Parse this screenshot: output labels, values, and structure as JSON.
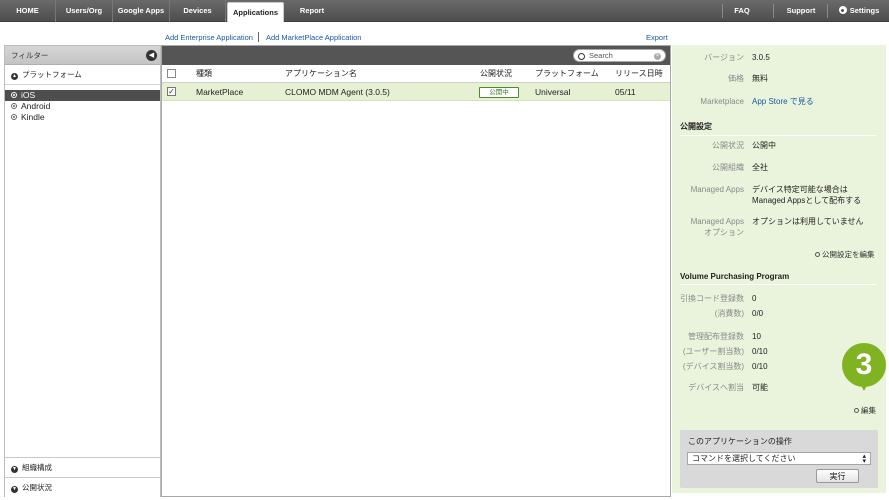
{
  "nav": {
    "tabs": [
      "HOME",
      "Users/Org",
      "Google Apps",
      "Devices",
      "Applications",
      "Report"
    ],
    "active": "Applications",
    "right": {
      "faq": "FAQ",
      "support": "Support",
      "settings": "Settings"
    }
  },
  "links": {
    "add_enterprise": "Add Enterprise Application",
    "separator": "|",
    "add_marketplace": "Add MarketPlace Application",
    "export": "Export"
  },
  "filter": {
    "title": "フィルター",
    "platform_header": "プラットフォーム",
    "platforms": [
      "iOS",
      "Android",
      "Kindle"
    ],
    "selected_platform": "iOS",
    "org_section": "組織構成",
    "status_section": "公開状況"
  },
  "search": {
    "placeholder": "Search"
  },
  "table": {
    "columns": [
      "種類",
      "アプリケーション名",
      "公開状況",
      "プラットフォーム",
      "リリース日時"
    ],
    "rows": [
      {
        "type": "MarketPlace",
        "name": "CLOMO MDM Agent (3.0.5)",
        "status": "公開中",
        "platform": "Universal",
        "release": "05/11",
        "checked": true
      }
    ]
  },
  "detail": {
    "version_label": "バージョン",
    "version": "3.0.5",
    "price_label": "価格",
    "price": "無料",
    "marketplace_label": "Marketplace",
    "marketplace_link": "App Store で見る",
    "publish_settings": "公開設定",
    "status_label": "公開状況",
    "status": "公開中",
    "org_label": "公開組織",
    "org": "全社",
    "managed_label": "Managed Apps",
    "managed_value_1": "デバイス特定可能な場合は",
    "managed_value_2": "Managed Appsとして配布する",
    "managed_opt_label_1": "Managed Apps",
    "managed_opt_label_2": "オプション",
    "managed_opt_value": "オプションは利用していません",
    "edit_publish": "公開設定を編集",
    "vpp_title": "Volume Purchasing Program",
    "redeem_label": "引換コード登録数",
    "redeem": "0",
    "consumed_label": "(消費数)",
    "consumed": "0/0",
    "managed_count_label": "管理配布登録数",
    "managed_count": "10",
    "user_assign_label": "(ユーザー割当数)",
    "user_assign": "0/10",
    "device_assign_label": "(デバイス割当数)",
    "device_assign": "0/10",
    "device_alloc_label": "デバイスへ割当",
    "device_alloc": "可能",
    "edit": "編集"
  },
  "step_marker": "3",
  "operations": {
    "title": "このアプリケーションの操作",
    "select_value": "コマンドを選択してください",
    "run": "実行"
  },
  "colors": {
    "accent_green": "#7fb322",
    "selected_row": "#e6f1d4",
    "link": "#1a5aa0"
  }
}
